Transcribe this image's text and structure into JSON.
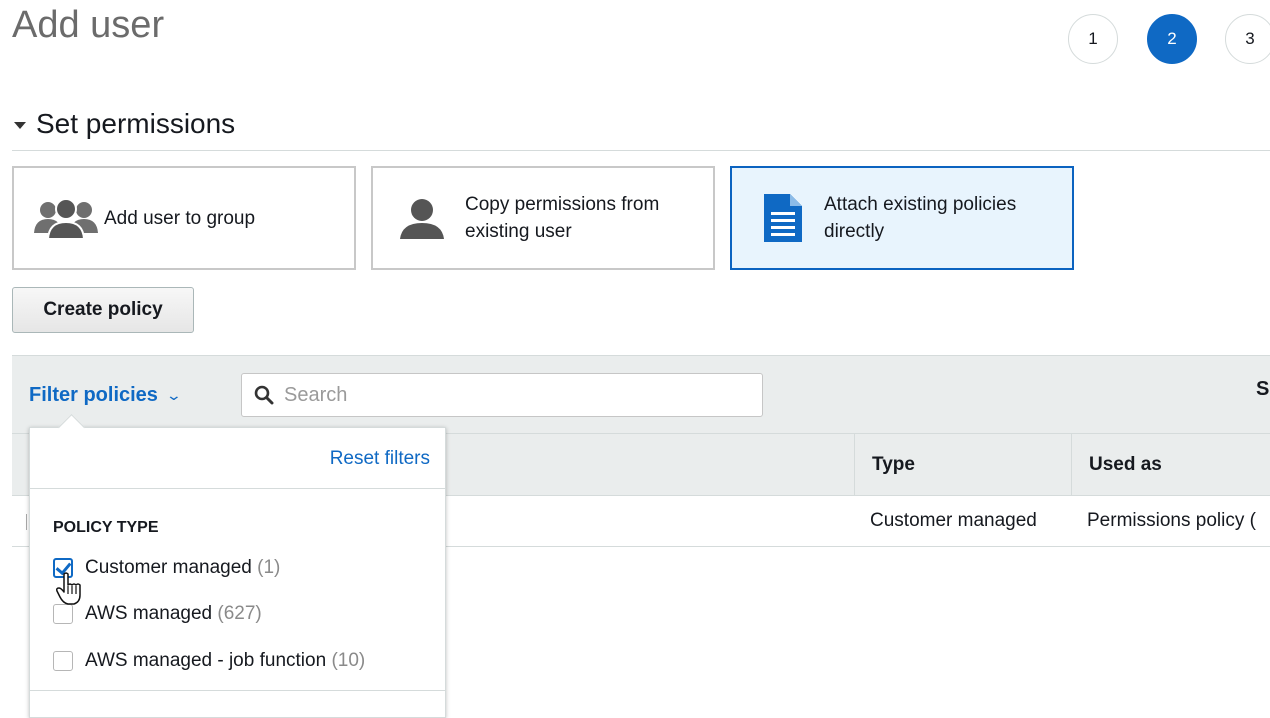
{
  "page": {
    "title": "Add user"
  },
  "steps": [
    "1",
    "2",
    "3"
  ],
  "active_step": "2",
  "section": {
    "title": "Set permissions"
  },
  "permission_options": [
    {
      "label": "Add user to group",
      "icon": "users-group-icon",
      "selected": false
    },
    {
      "label": "Copy permissions from existing user",
      "icon": "user-icon",
      "selected": false
    },
    {
      "label": "Attach existing policies directly",
      "icon": "document-icon",
      "selected": true
    }
  ],
  "actions": {
    "create_policy": "Create policy"
  },
  "toolbar": {
    "filter_label": "Filter policies",
    "search_placeholder": "Search",
    "right_label": "S"
  },
  "table": {
    "columns": [
      "Type",
      "Used as"
    ],
    "rows": [
      {
        "type": "Customer managed",
        "used_as": "Permissions policy ("
      }
    ]
  },
  "filter_dropdown": {
    "reset_label": "Reset filters",
    "group_title": "POLICY TYPE",
    "options": [
      {
        "label": "Customer managed",
        "count": "(1)",
        "checked": true
      },
      {
        "label": "AWS managed",
        "count": "(627)",
        "checked": false
      },
      {
        "label": "AWS managed - job function",
        "count": "(10)",
        "checked": false
      }
    ]
  },
  "colors": {
    "accent": "#0f69c4",
    "selected_bg": "#e8f4fd",
    "toolbar_bg": "#eaeded"
  }
}
